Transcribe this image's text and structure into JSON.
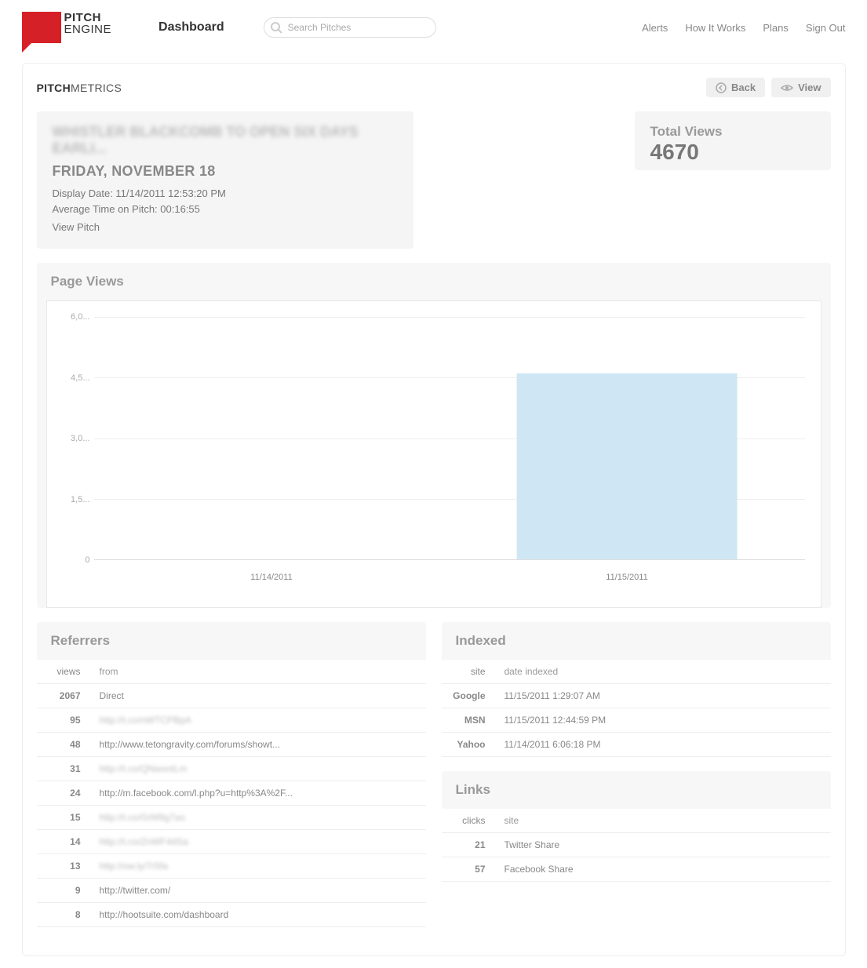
{
  "brand": {
    "line1": "PITCH",
    "line2": "ENGINE"
  },
  "header": {
    "dashboard": "Dashboard",
    "search_placeholder": "Search Pitches",
    "nav": [
      "Alerts",
      "How It Works",
      "Plans",
      "Sign Out"
    ]
  },
  "page": {
    "title_bold": "PITCH",
    "title_rest": "METRICS",
    "back": "Back",
    "view": "View"
  },
  "info": {
    "pitch_title": "WHISTLER BLACKCOMB TO OPEN SIX DAYS EARLI...",
    "pitch_date": "FRIDAY, NOVEMBER 18",
    "display_date": "Display Date: 11/14/2011 12:53:20 PM",
    "avg_time": "Average Time on Pitch: 00:16:55",
    "view_pitch": "View Pitch"
  },
  "total": {
    "label": "Total Views",
    "value": "4670"
  },
  "page_views": {
    "title": "Page Views"
  },
  "chart_data": {
    "type": "bar",
    "categories": [
      "11/14/2011",
      "11/15/2011"
    ],
    "values": [
      0,
      4600
    ],
    "title": "Page Views",
    "xlabel": "",
    "ylabel": "",
    "ylim": [
      0,
      6000
    ],
    "y_ticks": [
      0,
      1500,
      3000,
      4500,
      6000
    ],
    "y_tick_labels": [
      "0",
      "1,5...",
      "3,0...",
      "4,5...",
      "6,0..."
    ]
  },
  "referrers": {
    "title": "Referrers",
    "header": {
      "views": "views",
      "from": "from"
    },
    "rows": [
      {
        "views": "2067",
        "from": "Direct",
        "blur": false
      },
      {
        "views": "95",
        "from": "http://t.co/nWTCPBpA",
        "blur": true
      },
      {
        "views": "48",
        "from": "http://www.tetongravity.com/forums/showt...",
        "blur": false
      },
      {
        "views": "31",
        "from": "http://t.co/QNwsntLm",
        "blur": true
      },
      {
        "views": "24",
        "from": "http://m.facebook.com/l.php?u=http%3A%2F...",
        "blur": false
      },
      {
        "views": "15",
        "from": "http://t.co/GrM9g7ao",
        "blur": true
      },
      {
        "views": "14",
        "from": "http://t.co/ZnWF4dSa",
        "blur": true
      },
      {
        "views": "13",
        "from": "http://ow.ly/7r5fa",
        "blur": true
      },
      {
        "views": "9",
        "from": "http://twitter.com/",
        "blur": false
      },
      {
        "views": "8",
        "from": "http://hootsuite.com/dashboard",
        "blur": false
      }
    ]
  },
  "indexed": {
    "title": "Indexed",
    "header": {
      "site": "site",
      "date": "date indexed"
    },
    "rows": [
      {
        "site": "Google",
        "date": "11/15/2011 1:29:07 AM"
      },
      {
        "site": "MSN",
        "date": "11/15/2011 12:44:59 PM"
      },
      {
        "site": "Yahoo",
        "date": "11/14/2011 6:06:18 PM"
      }
    ]
  },
  "links": {
    "title": "Links",
    "header": {
      "clicks": "clicks",
      "site": "site"
    },
    "rows": [
      {
        "clicks": "21",
        "site": "Twitter Share"
      },
      {
        "clicks": "57",
        "site": "Facebook Share"
      }
    ]
  }
}
